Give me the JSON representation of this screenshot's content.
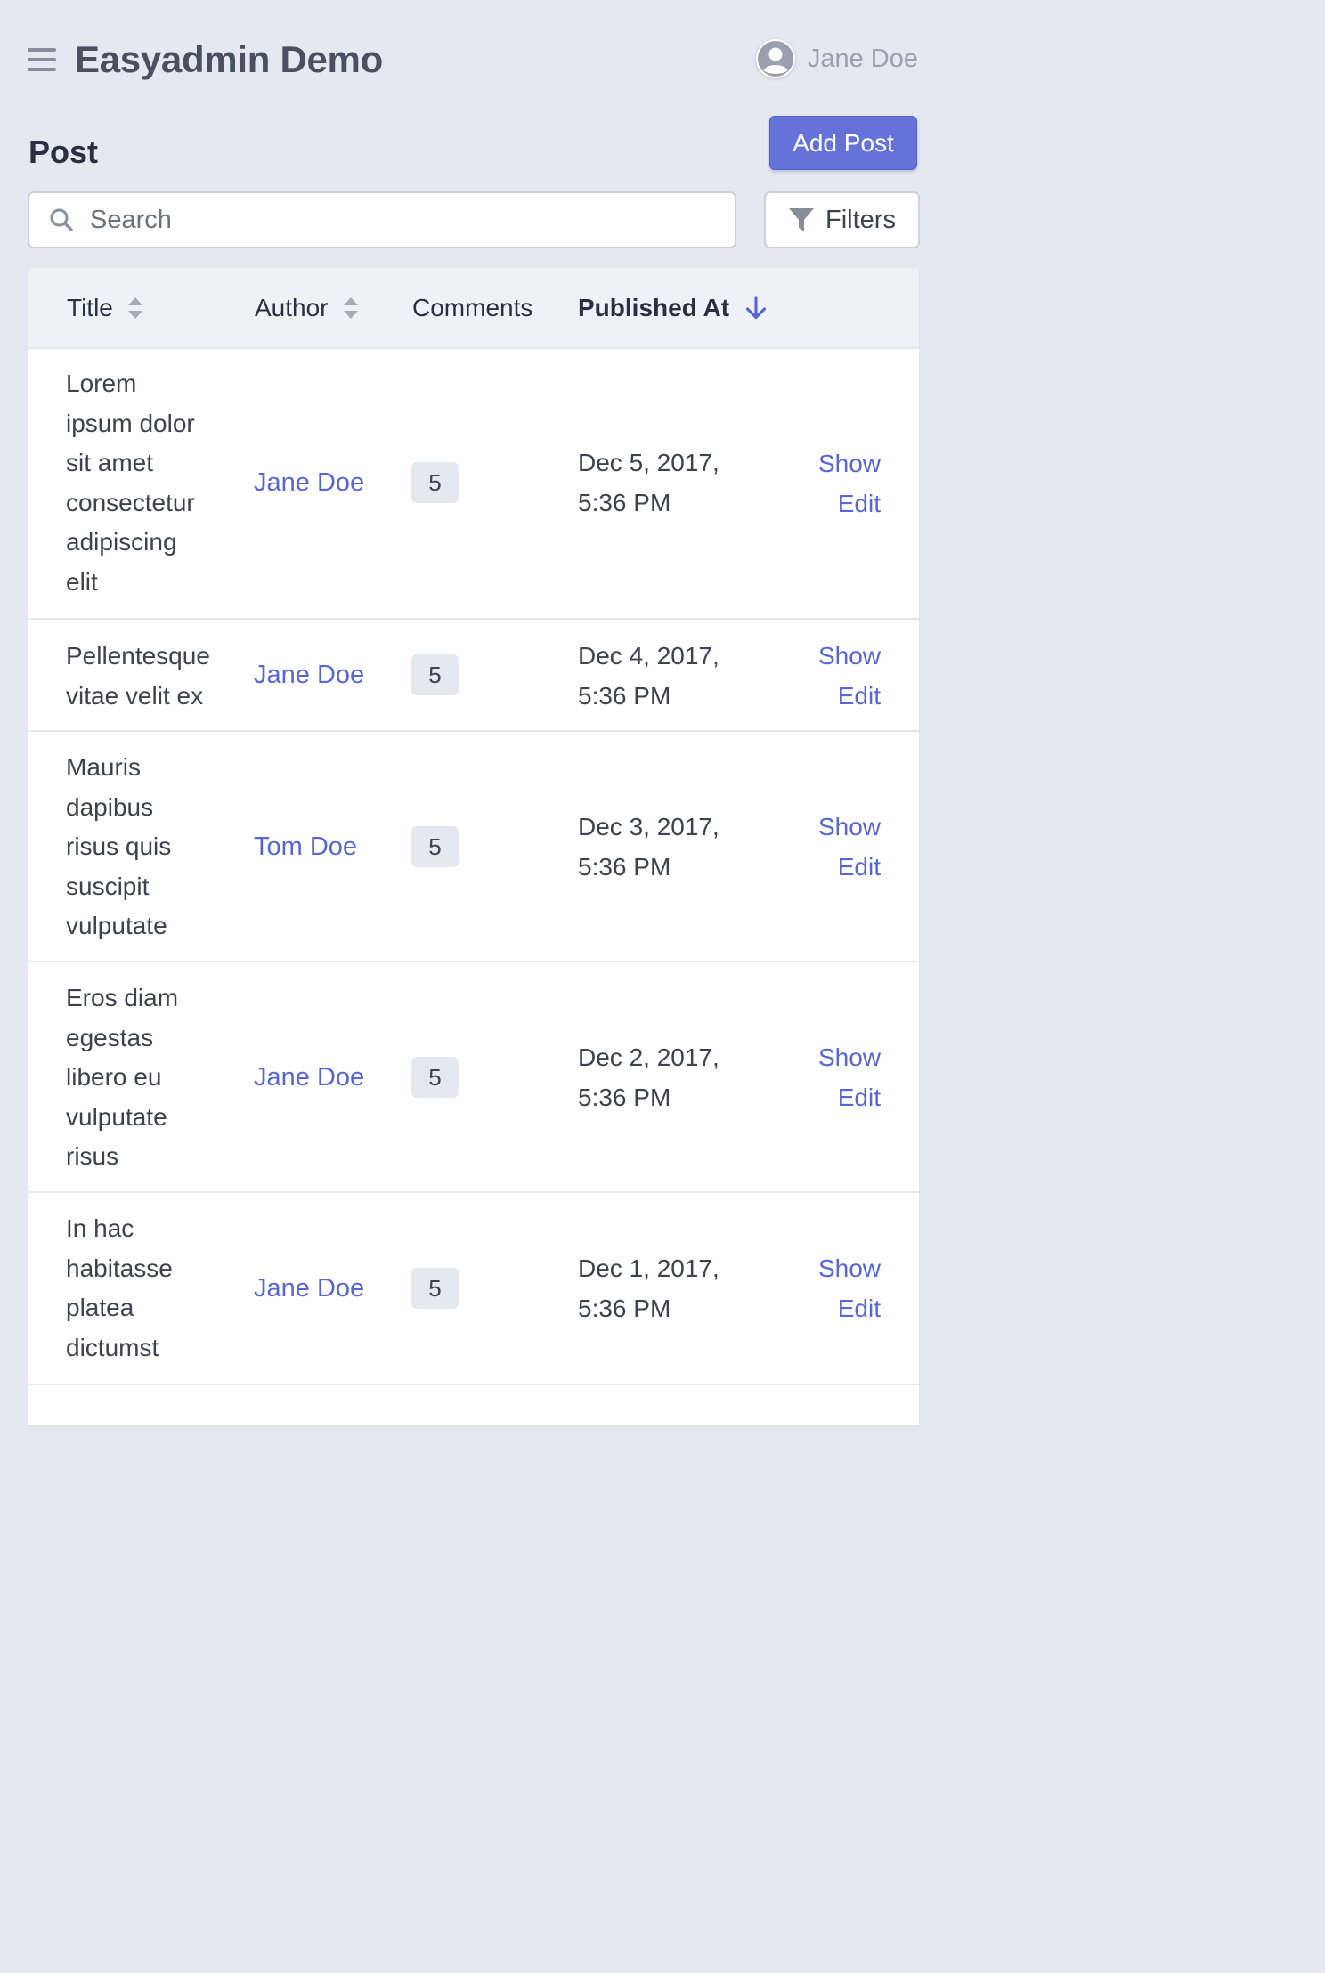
{
  "header": {
    "app_title": "Easyadmin Demo",
    "user_name": "Jane Doe"
  },
  "page": {
    "title": "Post",
    "add_button_label": "Add Post"
  },
  "search": {
    "placeholder": "Search",
    "value": ""
  },
  "filters_label": "Filters",
  "table": {
    "columns": [
      {
        "label": "Title",
        "sortable": true,
        "sorted": false
      },
      {
        "label": "Author",
        "sortable": true,
        "sorted": false
      },
      {
        "label": "Comments",
        "sortable": false,
        "sorted": false
      },
      {
        "label": "Published At",
        "sortable": true,
        "sorted": true,
        "direction": "desc"
      }
    ],
    "rows": [
      {
        "title_lines": [
          "Lorem",
          "ipsum dolor",
          "sit amet",
          "consectetur",
          "adipiscing",
          "elit"
        ],
        "author": "Jane Doe",
        "comments": "5",
        "date_lines": [
          "Dec 5, 2017,",
          "5:36 PM"
        ],
        "show_label": "Show",
        "edit_label": "Edit"
      },
      {
        "title_lines": [
          "Pellentesque",
          "vitae velit ex"
        ],
        "author": "Jane Doe",
        "comments": "5",
        "date_lines": [
          "Dec 4, 2017,",
          "5:36 PM"
        ],
        "show_label": "Show",
        "edit_label": "Edit"
      },
      {
        "title_lines": [
          "Mauris",
          "dapibus",
          "risus quis",
          "suscipit",
          "vulputate"
        ],
        "author": "Tom Doe",
        "comments": "5",
        "date_lines": [
          "Dec 3, 2017,",
          "5:36 PM"
        ],
        "show_label": "Show",
        "edit_label": "Edit"
      },
      {
        "title_lines": [
          "Eros diam",
          "egestas",
          "libero eu",
          "vulputate",
          "risus"
        ],
        "author": "Jane Doe",
        "comments": "5",
        "date_lines": [
          "Dec 2, 2017,",
          "5:36 PM"
        ],
        "show_label": "Show",
        "edit_label": "Edit"
      },
      {
        "title_lines": [
          "In hac",
          "habitasse",
          "platea",
          "dictumst"
        ],
        "author": "Jane Doe",
        "comments": "5",
        "date_lines": [
          "Dec 1, 2017,",
          "5:36 PM"
        ],
        "show_label": "Show",
        "edit_label": "Edit"
      }
    ]
  },
  "colors": {
    "accent": "#6573d8",
    "link": "#5866d4",
    "background": "#e5e8f0",
    "table_header": "#eef1f6"
  },
  "icons": {
    "menu": "hamburger-icon",
    "user": "user-circle-icon",
    "search": "search-icon",
    "filter": "funnel-icon",
    "sort": "sort-icon",
    "sorted_desc": "arrow-down-icon"
  }
}
